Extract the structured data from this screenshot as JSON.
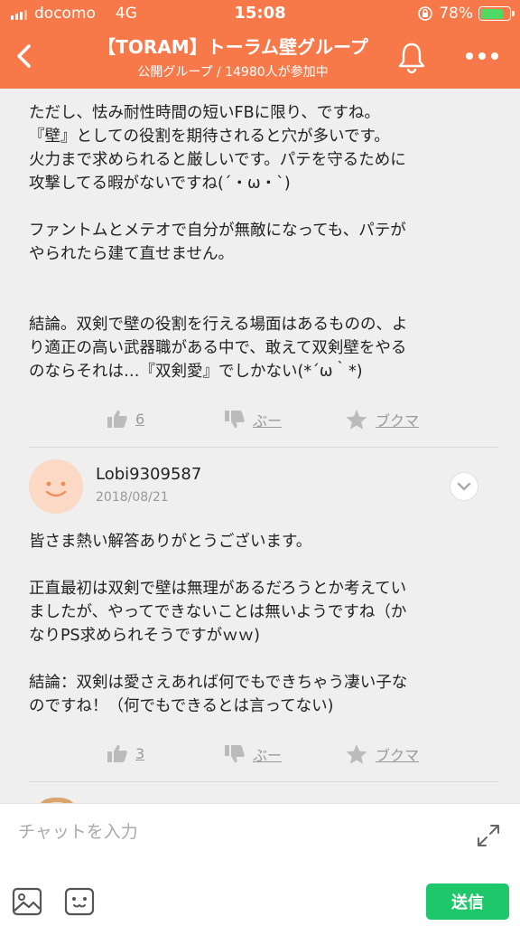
{
  "status": {
    "carrier": "docomo",
    "network": "4G",
    "time": "15:08",
    "battery": "78%",
    "battery_level": 0.78
  },
  "header": {
    "title": "【TORAM】トーラム壁グループ",
    "subtitle": "公開グループ / 14980人が参加中"
  },
  "post1": {
    "lines": [
      "ただし、怯み耐性時間の短いFBに限り、ですね。",
      "『壁』としての役割を期待されると穴が多いです。",
      "火力まで求められると厳しいです。パテを守るために",
      "攻撃してる暇がないですね(´・ω・`)",
      "",
      "ファントムとメテオで自分が無敵になっても、パテが",
      "やられたら建て直せません。",
      "",
      "",
      "結論。双剣で壁の役割を行える場面はあるものの、よ",
      "り適正の高い武器職がある中で、敢えて双剣壁をやる",
      "のならそれは…『双剣愛』でしかない(*´ω｀*)"
    ],
    "likes": "6",
    "boo": "ぶー",
    "bookmark": "ブクマ"
  },
  "post2": {
    "user": "Lobi9309587",
    "date": "2018/08/21",
    "lines": [
      "皆さま熱い解答ありがとうございます。",
      "",
      "正直最初は双剣で壁は無理があるだろうとか考えてい",
      "ましたが、やってできないことは無いようですね（か",
      "なりPS求められそうですがｗｗ)",
      "",
      "結論：双剣は愛さえあれば何でもできちゃう凄い子な",
      "のですね！（何でもできるとは言ってない)"
    ],
    "likes": "3",
    "boo": "ぶー",
    "bookmark": "ブクマ"
  },
  "footer": {
    "placeholder": "チャットを入力",
    "send_label": "送信"
  },
  "colors": {
    "accent": "#f7794a",
    "send": "#1ec76a",
    "muted": "#999999"
  },
  "icons": [
    "back-icon",
    "bell-icon",
    "more-icon",
    "thumbs-up-icon",
    "thumbs-down-icon",
    "star-icon",
    "chevron-down-icon",
    "expand-icon",
    "image-icon",
    "emoji-icon"
  ]
}
